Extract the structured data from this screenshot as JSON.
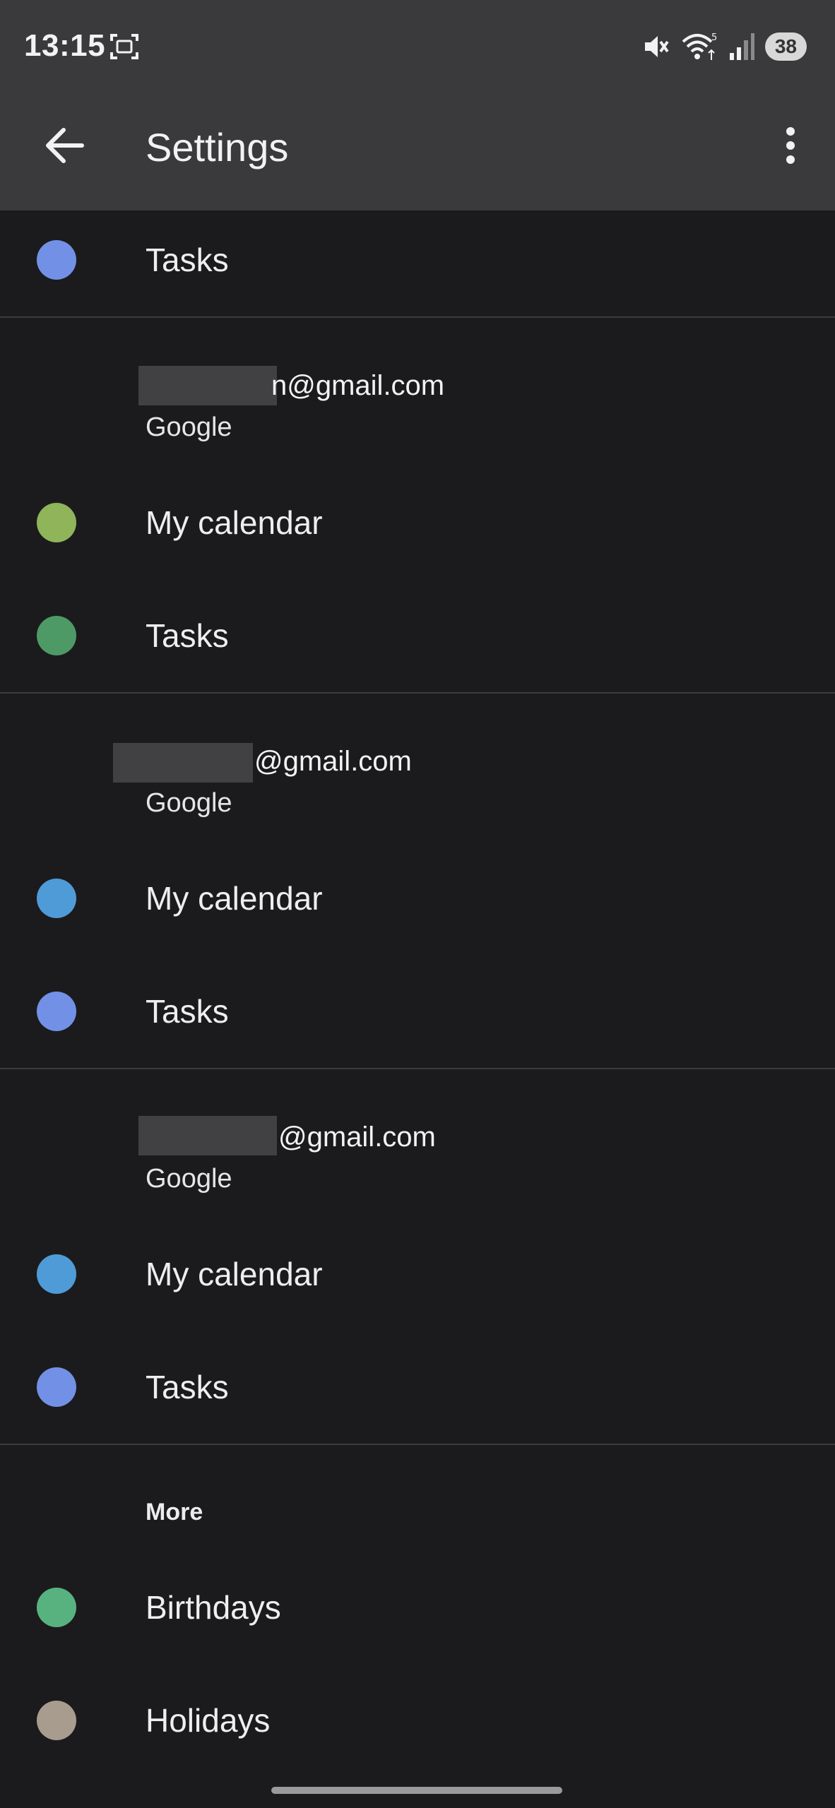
{
  "status_bar": {
    "time": "13:15",
    "battery": "38",
    "icons": [
      "screenshot-icon",
      "mute-icon",
      "wifi-icon",
      "signal-icon",
      "battery-icon"
    ]
  },
  "app_bar": {
    "title": "Settings",
    "back_icon": "arrow-back-icon",
    "menu_icon": "more-vert-icon"
  },
  "top_item": {
    "label": "Tasks",
    "color": "#7291e6"
  },
  "accounts": [
    {
      "email_suffix": "@gmail.com",
      "partial_char": "n",
      "provider": "Google",
      "items": [
        {
          "label": "My calendar",
          "color": "#8fb45a"
        },
        {
          "label": "Tasks",
          "color": "#4e9a66"
        }
      ]
    },
    {
      "email_suffix": "@gmail.com",
      "partial_char": "",
      "provider": "Google",
      "items": [
        {
          "label": "My calendar",
          "color": "#4f9bd8"
        },
        {
          "label": "Tasks",
          "color": "#7291e6"
        }
      ]
    },
    {
      "email_suffix": "@gmail.com",
      "partial_char": "",
      "provider": "Google",
      "items": [
        {
          "label": "My calendar",
          "color": "#4f9bd8"
        },
        {
          "label": "Tasks",
          "color": "#7291e6"
        }
      ]
    }
  ],
  "more": {
    "title": "More",
    "items": [
      {
        "label": "Birthdays",
        "color": "#58b27f"
      },
      {
        "label": "Holidays",
        "color": "#a89c8f"
      }
    ]
  }
}
